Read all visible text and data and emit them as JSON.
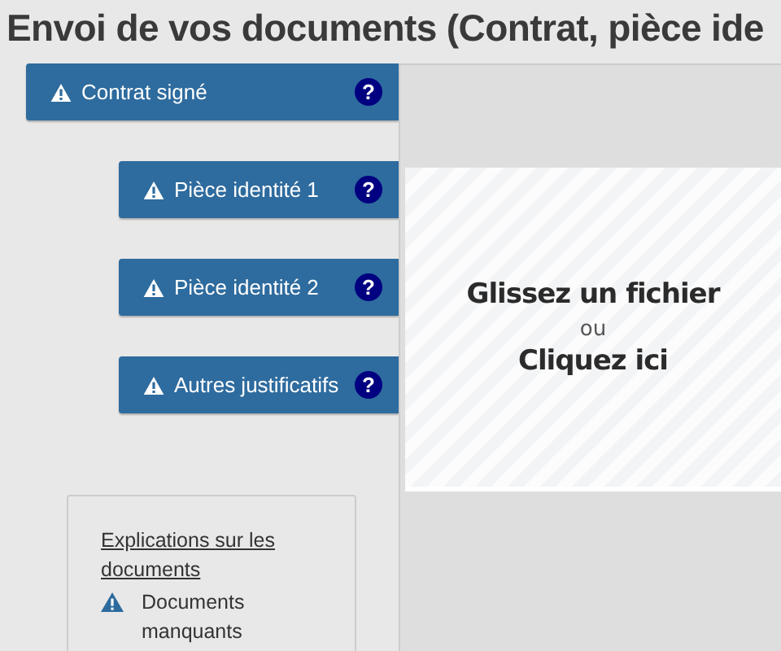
{
  "title": "Envoi de vos documents (Contrat, pièce ide",
  "documents": [
    {
      "label": "Contrat signé",
      "help": "?",
      "selected": true
    },
    {
      "label": "Pièce identité 1",
      "help": "?",
      "selected": false
    },
    {
      "label": "Pièce identité 2",
      "help": "?",
      "selected": false
    },
    {
      "label": "Autres justificatifs",
      "help": "?",
      "selected": false
    }
  ],
  "explanations": {
    "link": "Explications sur les documents",
    "legend": [
      {
        "label": "Documents manquants"
      }
    ]
  },
  "dropzone": {
    "primary": "Glissez un fichier",
    "separator": "ou",
    "secondary": "Cliquez ici"
  }
}
